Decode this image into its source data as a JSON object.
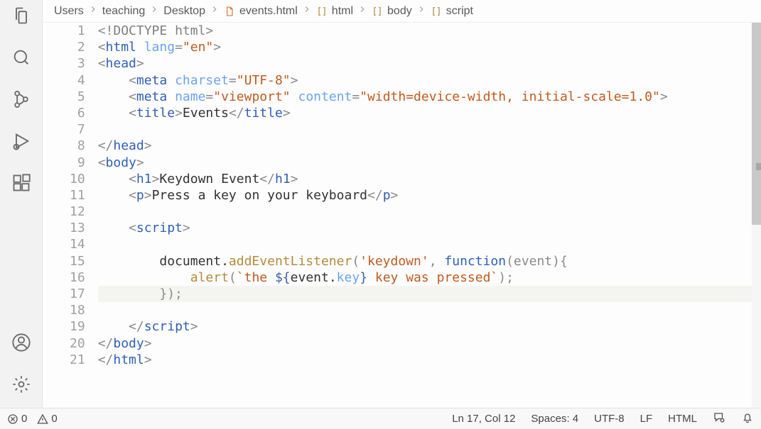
{
  "breadcrumbs": [
    "Users",
    "teaching",
    "Desktop",
    "events.html",
    "html",
    "body",
    "script"
  ],
  "bcIcons": [
    "",
    "",
    "",
    "file",
    "brackets",
    "brackets",
    "brackets"
  ],
  "code": {
    "lines": [
      [
        {
          "t": "<!",
          "c": "punct"
        },
        {
          "t": "DOCTYPE html",
          "c": "doctype"
        },
        {
          "t": ">",
          "c": "punct"
        }
      ],
      [
        {
          "t": "<",
          "c": "punct"
        },
        {
          "t": "html ",
          "c": "tag"
        },
        {
          "t": "lang",
          "c": "attr"
        },
        {
          "t": "=",
          "c": "punct"
        },
        {
          "t": "\"en\"",
          "c": "string"
        },
        {
          "t": ">",
          "c": "punct"
        }
      ],
      [
        {
          "t": "<",
          "c": "punct"
        },
        {
          "t": "head",
          "c": "tag"
        },
        {
          "t": ">",
          "c": "punct"
        }
      ],
      [
        {
          "t": "    <",
          "c": "punct"
        },
        {
          "t": "meta ",
          "c": "tag"
        },
        {
          "t": "charset",
          "c": "attr"
        },
        {
          "t": "=",
          "c": "punct"
        },
        {
          "t": "\"UTF-8\"",
          "c": "string"
        },
        {
          "t": ">",
          "c": "punct"
        }
      ],
      [
        {
          "t": "    <",
          "c": "punct"
        },
        {
          "t": "meta ",
          "c": "tag"
        },
        {
          "t": "name",
          "c": "attr"
        },
        {
          "t": "=",
          "c": "punct"
        },
        {
          "t": "\"viewport\" ",
          "c": "string"
        },
        {
          "t": "content",
          "c": "attr"
        },
        {
          "t": "=",
          "c": "punct"
        },
        {
          "t": "\"width=device-width, initial-scale=1.0\"",
          "c": "string"
        },
        {
          "t": ">",
          "c": "punct"
        }
      ],
      [
        {
          "t": "    <",
          "c": "punct"
        },
        {
          "t": "title",
          "c": "tag"
        },
        {
          "t": ">",
          "c": "punct"
        },
        {
          "t": "Events",
          "c": "text"
        },
        {
          "t": "</",
          "c": "punct"
        },
        {
          "t": "title",
          "c": "tag"
        },
        {
          "t": ">",
          "c": "punct"
        }
      ],
      [
        {
          "t": " ",
          "c": "text"
        }
      ],
      [
        {
          "t": "</",
          "c": "punct"
        },
        {
          "t": "head",
          "c": "tag"
        },
        {
          "t": ">",
          "c": "punct"
        }
      ],
      [
        {
          "t": "<",
          "c": "punct"
        },
        {
          "t": "body",
          "c": "tag"
        },
        {
          "t": ">",
          "c": "punct"
        }
      ],
      [
        {
          "t": "    <",
          "c": "punct"
        },
        {
          "t": "h1",
          "c": "tag"
        },
        {
          "t": ">",
          "c": "punct"
        },
        {
          "t": "Keydown Event",
          "c": "text"
        },
        {
          "t": "</",
          "c": "punct"
        },
        {
          "t": "h1",
          "c": "tag"
        },
        {
          "t": ">",
          "c": "punct"
        }
      ],
      [
        {
          "t": "    <",
          "c": "punct"
        },
        {
          "t": "p",
          "c": "tag"
        },
        {
          "t": ">",
          "c": "punct"
        },
        {
          "t": "Press a key on your keyboard",
          "c": "text"
        },
        {
          "t": "</",
          "c": "punct"
        },
        {
          "t": "p",
          "c": "tag"
        },
        {
          "t": ">",
          "c": "punct"
        }
      ],
      [
        {
          "t": " ",
          "c": "text"
        }
      ],
      [
        {
          "t": "    <",
          "c": "punct"
        },
        {
          "t": "script",
          "c": "tag"
        },
        {
          "t": ">",
          "c": "punct"
        }
      ],
      [
        {
          "t": " ",
          "c": "text"
        }
      ],
      [
        {
          "t": "        document.",
          "c": "text"
        },
        {
          "t": "addEventListener",
          "c": "fn-name"
        },
        {
          "t": "(",
          "c": "punct"
        },
        {
          "t": "'keydown'",
          "c": "string"
        },
        {
          "t": ", ",
          "c": "punct"
        },
        {
          "t": "function",
          "c": "keyword"
        },
        {
          "t": "(event){",
          "c": "punct"
        }
      ],
      [
        {
          "t": "            ",
          "c": "text"
        },
        {
          "t": "alert",
          "c": "fn-name"
        },
        {
          "t": "(",
          "c": "punct"
        },
        {
          "t": "`the ",
          "c": "string"
        },
        {
          "t": "${",
          "c": "tmpl"
        },
        {
          "t": "event.",
          "c": "text"
        },
        {
          "t": "key",
          "c": "attr"
        },
        {
          "t": "}",
          "c": "tmpl"
        },
        {
          "t": " key was pressed`",
          "c": "string"
        },
        {
          "t": ");",
          "c": "punct"
        }
      ],
      [
        {
          "t": "        });",
          "c": "punct"
        }
      ],
      [
        {
          "t": " ",
          "c": "text"
        }
      ],
      [
        {
          "t": "    </",
          "c": "punct"
        },
        {
          "t": "script",
          "c": "tag"
        },
        {
          "t": ">",
          "c": "punct"
        }
      ],
      [
        {
          "t": "</",
          "c": "punct"
        },
        {
          "t": "body",
          "c": "tag"
        },
        {
          "t": ">",
          "c": "punct"
        }
      ],
      [
        {
          "t": "</",
          "c": "punct"
        },
        {
          "t": "html",
          "c": "tag"
        },
        {
          "t": ">",
          "c": "punct"
        }
      ]
    ],
    "highlighted_line": 17
  },
  "statusBar": {
    "errors": "0",
    "warnings": "0",
    "cursor": "Ln 17, Col 12",
    "spaces": "Spaces: 4",
    "encoding": "UTF-8",
    "eol": "LF",
    "language": "HTML"
  }
}
